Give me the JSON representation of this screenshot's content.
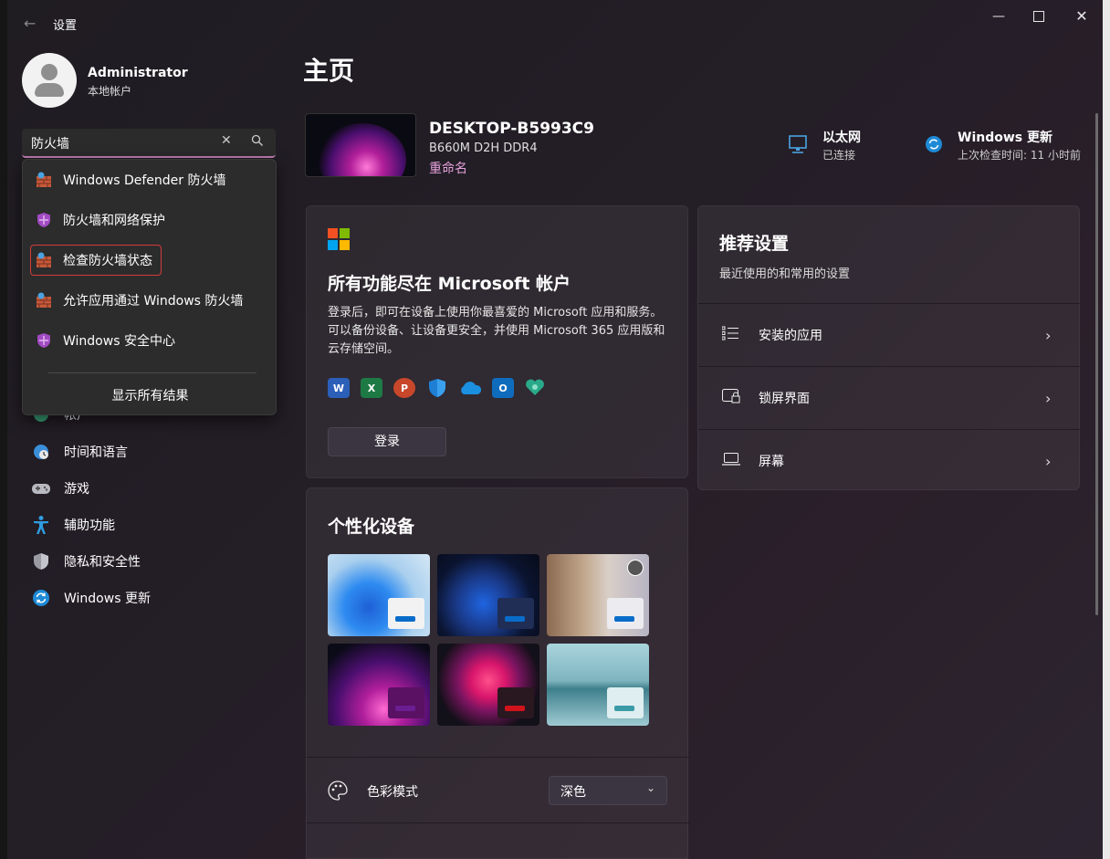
{
  "window": {
    "title": "设置",
    "controls": [
      "minimize",
      "maximize",
      "close"
    ]
  },
  "user": {
    "name": "Administrator",
    "account_type": "本地帐户"
  },
  "search": {
    "value": "防火墙",
    "results": [
      {
        "label": "Windows Defender 防火墙",
        "icon": "firewall-icon"
      },
      {
        "label": "防火墙和网络保护",
        "icon": "shield-icon"
      },
      {
        "label": "检查防火墙状态",
        "icon": "firewall-icon",
        "highlighted": true
      },
      {
        "label": "允许应用通过 Windows 防火墙",
        "icon": "firewall-icon"
      },
      {
        "label": "Windows 安全中心",
        "icon": "shield-icon"
      }
    ],
    "show_all": "显示所有结果"
  },
  "sidebar": {
    "partial_item": "帐户",
    "items": [
      {
        "label": "时间和语言",
        "icon": "clock-globe-icon"
      },
      {
        "label": "游戏",
        "icon": "gamepad-icon"
      },
      {
        "label": "辅助功能",
        "icon": "accessibility-icon"
      },
      {
        "label": "隐私和安全性",
        "icon": "shield-icon"
      },
      {
        "label": "Windows 更新",
        "icon": "update-icon"
      }
    ]
  },
  "main": {
    "page_title": "主页",
    "device": {
      "name": "DESKTOP-B5993C9",
      "model": "B660M D2H DDR4",
      "rename": "重命名"
    },
    "network": {
      "title": "以太网",
      "status": "已连接"
    },
    "update": {
      "title": "Windows 更新",
      "status": "上次检查时间: 11 小时前"
    },
    "microsoft_card": {
      "title": "所有功能尽在 Microsoft 帐户",
      "description": "登录后，即可在设备上使用你最喜爱的 Microsoft 应用和服务。可以备份设备、让设备更安全，并使用 Microsoft 365 应用版和云存储空间。",
      "apps": [
        "word-icon",
        "excel-icon",
        "powerpoint-icon",
        "defender-icon",
        "onedrive-icon",
        "outlook-icon",
        "family-icon"
      ],
      "signin_button": "登录"
    },
    "recommended": {
      "title": "推荐设置",
      "subtitle": "最近使用的和常用的设置",
      "items": [
        {
          "label": "安装的应用",
          "icon": "list-icon"
        },
        {
          "label": "锁屏界面",
          "icon": "lockscreen-icon"
        },
        {
          "label": "屏幕",
          "icon": "laptop-icon"
        }
      ]
    },
    "personalize": {
      "title": "个性化设备",
      "themes": [
        {
          "name": "windows-light",
          "accent": "#0a6cc9"
        },
        {
          "name": "windows-dark",
          "accent": "#0a6cc9"
        },
        {
          "name": "glow",
          "accent": "#0a6cc9"
        },
        {
          "name": "captured-motion",
          "accent": "#6a1e91"
        },
        {
          "name": "flow",
          "accent": "#d1131c"
        },
        {
          "name": "sunrise",
          "accent": "#3a9aa6"
        }
      ],
      "color_mode_label": "色彩模式",
      "color_mode_value": "深色"
    }
  },
  "colors": {
    "accent_pink": "#c27db3",
    "highlight_border": "#d53b3b"
  }
}
